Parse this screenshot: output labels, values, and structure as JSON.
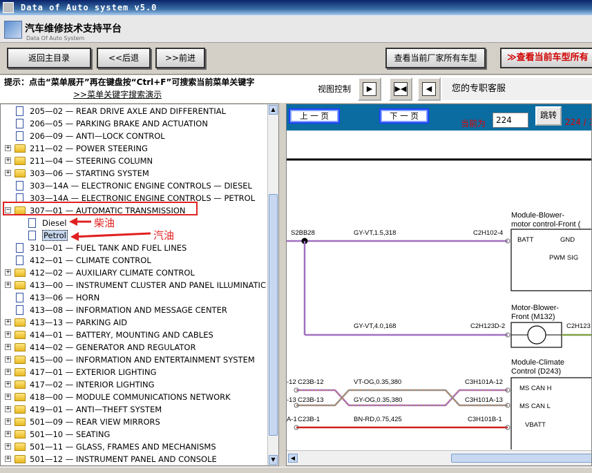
{
  "window": {
    "title": "Data of Auto system v5.0"
  },
  "app": {
    "title_cn": "汽车维修技术支持平台",
    "title_en": "Data Of Auto System"
  },
  "toolbar": {
    "back_main": "返回主目录",
    "prev": "<<后退",
    "next": ">>前进",
    "all_models": "查看当前厂家所有车型",
    "current_model": "≫查看当前车型所有"
  },
  "hint": {
    "text": "提示：点击“菜单展开”再在键盘按“Ctrl+F”可搜索当前菜单关键字",
    "link": ">>菜单关键字搜索演示"
  },
  "view_control": {
    "label": "视图控制",
    "advisor": "您的专职客服"
  },
  "tree": {
    "items": [
      {
        "label": "205—02 — REAR DRIVE AXLE AND DIFFERENTIAL",
        "type": "doc",
        "expander": ""
      },
      {
        "label": "206—05 — PARKING BRAKE AND ACTUATION",
        "type": "doc",
        "expander": ""
      },
      {
        "label": "206—09 — ANTI—LOCK CONTROL",
        "type": "doc",
        "expander": ""
      },
      {
        "label": "211—02 — POWER STEERING",
        "type": "folder",
        "expander": "+"
      },
      {
        "label": "211—04 — STEERING COLUMN",
        "type": "folder",
        "expander": "+"
      },
      {
        "label": "303—06 — STARTING SYSTEM",
        "type": "folder",
        "expander": "+"
      },
      {
        "label": "303—14A — ELECTRONIC ENGINE CONTROLS — DIESEL",
        "type": "doc",
        "expander": ""
      },
      {
        "label": "303—14A — ELECTRONIC ENGINE CONTROLS — PETROL",
        "type": "doc",
        "expander": ""
      },
      {
        "label": "307—01 — AUTOMATIC TRANSMISSION",
        "type": "folder",
        "expander": "−"
      },
      {
        "label": "Diesel",
        "type": "doc",
        "expander": "",
        "child": true
      },
      {
        "label": "Petrol",
        "type": "doc",
        "expander": "",
        "child": true,
        "selected": true
      },
      {
        "label": "310—01 — FUEL TANK AND FUEL LINES",
        "type": "doc",
        "expander": ""
      },
      {
        "label": "412—01 — CLIMATE CONTROL",
        "type": "doc",
        "expander": ""
      },
      {
        "label": "412—02 — AUXILIARY CLIMATE CONTROL",
        "type": "folder",
        "expander": "+"
      },
      {
        "label": "413—00 — INSTRUMENT CLUSTER AND PANEL ILLUMINATIC",
        "type": "folder",
        "expander": "+"
      },
      {
        "label": "413—06 — HORN",
        "type": "doc",
        "expander": ""
      },
      {
        "label": "413—08 — INFORMATION AND MESSAGE CENTER",
        "type": "doc",
        "expander": ""
      },
      {
        "label": "413—13 — PARKING AID",
        "type": "folder",
        "expander": "+"
      },
      {
        "label": "414—01 — BATTERY, MOUNTING AND CABLES",
        "type": "folder",
        "expander": "+"
      },
      {
        "label": "414—02 — GENERATOR AND REGULATOR",
        "type": "folder",
        "expander": "+"
      },
      {
        "label": "415—00 — INFORMATION AND ENTERTAINMENT SYSTEM",
        "type": "folder",
        "expander": "+"
      },
      {
        "label": "417—01 — EXTERIOR LIGHTING",
        "type": "folder",
        "expander": "+"
      },
      {
        "label": "417—02 — INTERIOR LIGHTING",
        "type": "folder",
        "expander": "+"
      },
      {
        "label": "418—00 — MODULE COMMUNICATIONS NETWORK",
        "type": "folder",
        "expander": "+"
      },
      {
        "label": "419—01 — ANTI—THEFT SYSTEM",
        "type": "folder",
        "expander": "+"
      },
      {
        "label": "501—09 — REAR VIEW MIRRORS",
        "type": "folder",
        "expander": "+"
      },
      {
        "label": "501—10 — SEATING",
        "type": "folder",
        "expander": "+"
      },
      {
        "label": "501—11 — GLASS, FRAMES AND MECHANISMS",
        "type": "folder",
        "expander": "+"
      },
      {
        "label": "501—12 — INSTRUMENT PANEL AND CONSOLE",
        "type": "folder",
        "expander": "+"
      }
    ]
  },
  "annotations": {
    "diesel": "柴油",
    "petrol": "汽油"
  },
  "pager": {
    "prev": "上 一 页",
    "next": "下 一 页",
    "current_label": "当前为",
    "current_value": "224",
    "go": "跳转",
    "total": "224 / 3"
  },
  "diagram": {
    "splice": "S2BB28",
    "wire1": "GY-VT,1.5,318",
    "conn1": "C2H102-4",
    "wire2": "GY-VT,4.0,168",
    "conn2": "C2H123D-2",
    "conn2b": "C2H123",
    "module1_title": "Module-Blower-",
    "module1_title2": "motor control-Front (",
    "module1_pins": [
      "BATT",
      "GND",
      "PWM SIG"
    ],
    "motor_title": "Motor-Blower-",
    "motor_title2": "Front (M132)",
    "module2_title": "Module-Climate",
    "module2_title2": "Control (D243)",
    "module2_pins": [
      "MS CAN H",
      "MS CAN L",
      "VBATT"
    ],
    "wire3": "VT-OG,0.35,380",
    "wire4": "GY-OG,0.35,380",
    "wire5": "BN-RD,0.75,425",
    "conn3": "C3H101A-12",
    "conn4": "C3H101A-13",
    "conn5": "C3H101B-1",
    "left1": "-12",
    "left1b": "C23B-12",
    "left2": "-13",
    "left2b": "C23B-13",
    "left3": "A-1",
    "left3b": "C23B-1"
  }
}
